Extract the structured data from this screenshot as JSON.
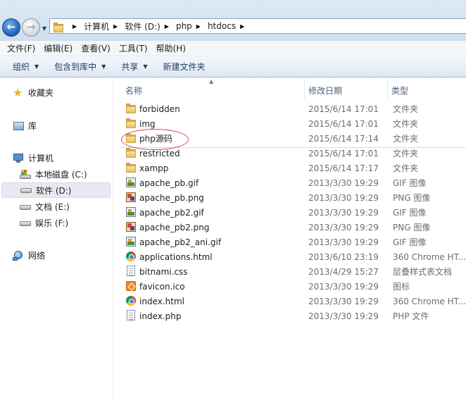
{
  "address": {
    "segments": [
      "计算机",
      "软件 (D:)",
      "php",
      "htdocs"
    ]
  },
  "menu": [
    "文件(F)",
    "编辑(E)",
    "查看(V)",
    "工具(T)",
    "帮助(H)"
  ],
  "commands": [
    {
      "label": "组织",
      "caret": true
    },
    {
      "label": "包含到库中",
      "caret": true
    },
    {
      "label": "共享",
      "caret": true
    },
    {
      "label": "新建文件夹",
      "caret": false
    }
  ],
  "nav": {
    "favorites": "收藏夹",
    "libraries": "库",
    "computer": "计算机",
    "drives": [
      "本地磁盘 (C:)",
      "软件 (D:)",
      "文档 (E:)",
      "娱乐 (F:)"
    ],
    "network": "网络"
  },
  "columns": {
    "name": "名称",
    "date": "修改日期",
    "type": "类型"
  },
  "files": [
    {
      "name": "forbidden",
      "date": "2015/6/14 17:01",
      "type": "文件夹",
      "icon": "folder"
    },
    {
      "name": "img",
      "date": "2015/6/14 17:01",
      "type": "文件夹",
      "icon": "folder"
    },
    {
      "name": "php源码",
      "date": "2015/6/14 17:14",
      "type": "文件夹",
      "icon": "folder"
    },
    {
      "name": "restricted",
      "date": "2015/6/14 17:01",
      "type": "文件夹",
      "icon": "folder"
    },
    {
      "name": "xampp",
      "date": "2015/6/14 17:17",
      "type": "文件夹",
      "icon": "folder"
    },
    {
      "name": "apache_pb.gif",
      "date": "2013/3/30 19:29",
      "type": "GIF 图像",
      "icon": "gif"
    },
    {
      "name": "apache_pb.png",
      "date": "2013/3/30 19:29",
      "type": "PNG 图像",
      "icon": "png"
    },
    {
      "name": "apache_pb2.gif",
      "date": "2013/3/30 19:29",
      "type": "GIF 图像",
      "icon": "gif"
    },
    {
      "name": "apache_pb2.png",
      "date": "2013/3/30 19:29",
      "type": "PNG 图像",
      "icon": "png"
    },
    {
      "name": "apache_pb2_ani.gif",
      "date": "2013/3/30 19:29",
      "type": "GIF 图像",
      "icon": "gif"
    },
    {
      "name": "applications.html",
      "date": "2013/6/10 23:19",
      "type": "360 Chrome HT...",
      "icon": "chrome"
    },
    {
      "name": "bitnami.css",
      "date": "2013/4/29 15:27",
      "type": "层叠样式表文档",
      "icon": "doc"
    },
    {
      "name": "favicon.ico",
      "date": "2013/3/30 19:29",
      "type": "图标",
      "icon": "ico"
    },
    {
      "name": "index.html",
      "date": "2013/3/30 19:29",
      "type": "360 Chrome HT...",
      "icon": "chrome"
    },
    {
      "name": "index.php",
      "date": "2013/3/30 19:29",
      "type": "PHP 文件",
      "icon": "doc"
    }
  ]
}
